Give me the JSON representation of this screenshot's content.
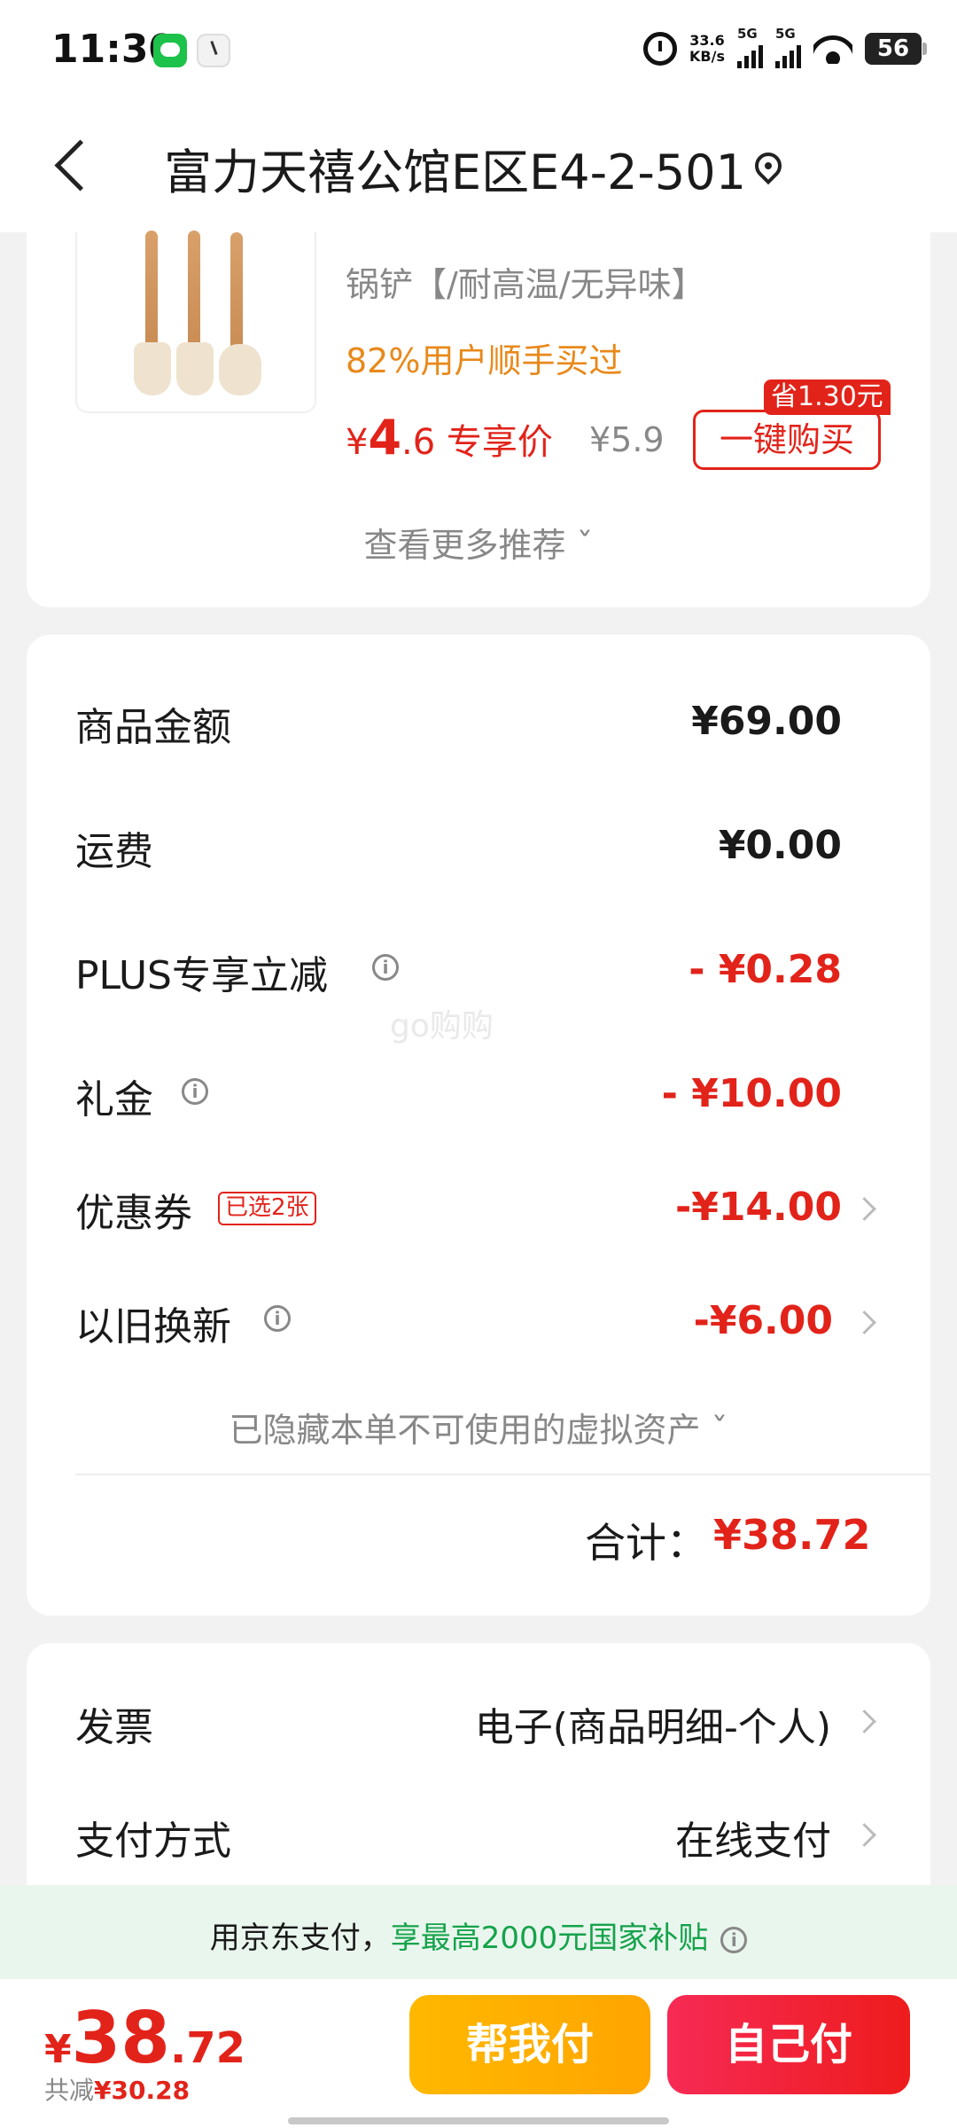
{
  "status": {
    "time": "11:30",
    "net_speed": "33.6",
    "net_unit": "KB/s",
    "sig1": "5G",
    "sig2": "5G",
    "battery": "56"
  },
  "header": {
    "address": "富力天禧公馆E区E4-2-501"
  },
  "recommend": {
    "name": "锅铲【/耐高温/无异味】",
    "buy_rate": "82%用户顺手买过",
    "currency": "¥",
    "price_int": "4",
    "price_dec": ".6",
    "price_label": "专享价",
    "orig_price": "¥5.9",
    "save_badge": "省1.30元",
    "buy_button": "一键购买",
    "more": "查看更多推荐 ˇ"
  },
  "summary": {
    "rows": [
      {
        "label": "商品金额",
        "value": "¥69.00"
      },
      {
        "label": "运费",
        "value": "¥0.00"
      },
      {
        "label": "PLUS专享立减",
        "value": "- ¥0.28"
      },
      {
        "label": "礼金",
        "value": "- ¥10.00"
      },
      {
        "label": "优惠券",
        "value": "-¥14.00",
        "tag": "已选2张"
      },
      {
        "label": "以旧换新",
        "value": "-¥6.00"
      }
    ],
    "hidden_assets": "已隐藏本单不可使用的虚拟资产 ˇ",
    "total_label": "合计：",
    "total_value": "¥38.72",
    "watermark": "go购购"
  },
  "options": {
    "invoice_label": "发票",
    "invoice_value": "电子(商品明细-个人)",
    "payment_label": "支付方式",
    "payment_value": "在线支付"
  },
  "banner": {
    "prefix": "用京东支付，",
    "highlight": "享最高2000元国家补贴"
  },
  "bottom": {
    "currency": "¥",
    "price_int": "38",
    "price_dec": ".72",
    "reduce_label": "共减",
    "reduce_value": "¥30.28",
    "help_pay": "帮我付",
    "self_pay": "自己付"
  },
  "colors": {
    "red": "#e2231a",
    "orange": "#e8891b",
    "green": "#15a34a",
    "yellow": "#ffb800"
  }
}
